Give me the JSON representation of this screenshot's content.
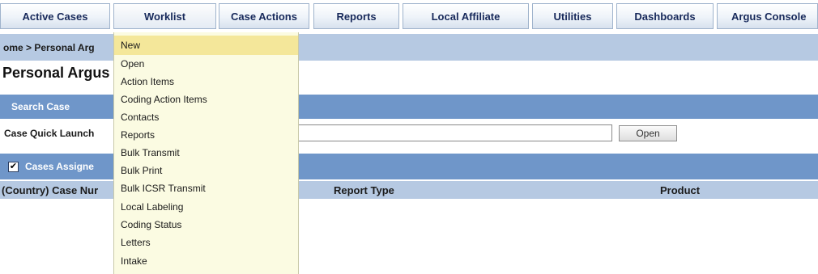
{
  "nav": {
    "tabs": [
      {
        "label": "Active Cases"
      },
      {
        "label": "Worklist"
      },
      {
        "label": "Case Actions"
      },
      {
        "label": "Reports"
      },
      {
        "label": "Local Affiliate"
      },
      {
        "label": "Utilities"
      },
      {
        "label": "Dashboards"
      },
      {
        "label": "Argus Console"
      }
    ]
  },
  "breadcrumb": "ome > Personal Arg",
  "page_title": "Personal Argus",
  "search_case": {
    "section_title": "Search Case",
    "quick_launch_label": "Case Quick Launch",
    "input_value": "",
    "open_label": "Open"
  },
  "cases_assigned": {
    "section_title": "Cases Assigne",
    "checked": true,
    "columns": [
      "(Country) Case Nur",
      "Report Type",
      "Product"
    ]
  },
  "menu": {
    "items": [
      {
        "label": "New",
        "highlighted": true
      },
      {
        "label": "Open"
      },
      {
        "label": "Action Items"
      },
      {
        "label": "Coding Action Items"
      },
      {
        "label": "Contacts"
      },
      {
        "label": "Reports"
      },
      {
        "label": "Bulk Transmit"
      },
      {
        "label": "Bulk Print"
      },
      {
        "label": "Bulk ICSR Transmit"
      },
      {
        "label": "Local Labeling"
      },
      {
        "label": "Coding Status"
      },
      {
        "label": "Letters"
      },
      {
        "label": "Intake"
      }
    ]
  },
  "colors": {
    "nav_text": "#16285a",
    "band_blue": "#6f96c9",
    "light_band": "#b6c9e2",
    "menu_bg": "#fbfbe2",
    "menu_highlight": "#f4e79a"
  }
}
